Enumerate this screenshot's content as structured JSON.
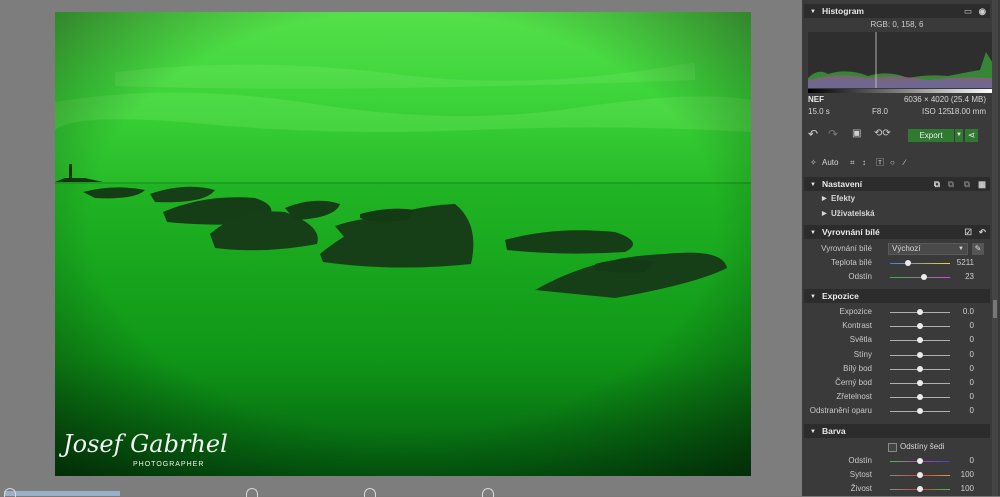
{
  "histogram": {
    "title": "Histogram",
    "rgb": "RGB: 0, 158, 6"
  },
  "file_info": {
    "format": "NEF",
    "dimensions": "6036 × 4020 (25.4 MB)",
    "shutter": "15.0 s",
    "aperture": "F8.0",
    "iso": "ISO 125",
    "focal": "18.00 mm"
  },
  "toolbar": {
    "export_label": "Export"
  },
  "tools": {
    "auto_label": "Auto"
  },
  "nastaveni": {
    "title": "Nastavení",
    "efekty": "Efekty",
    "uzivatelska": "Uživatelská"
  },
  "vyrovnani": {
    "title": "Vyrovnání bílé",
    "preset_label": "Vyrovnání bílé",
    "preset_value": "Výchozí",
    "sliders": [
      {
        "label": "Teplota bílé",
        "value": "5211",
        "pos": 0.3
      },
      {
        "label": "Odstín",
        "value": "23",
        "pos": 0.57
      }
    ]
  },
  "expozice": {
    "title": "Expozice",
    "sliders": [
      {
        "label": "Expozice",
        "value": "0.0",
        "pos": 0.5
      },
      {
        "label": "Kontrast",
        "value": "0",
        "pos": 0.5
      },
      {
        "label": "Světla",
        "value": "0",
        "pos": 0.5
      },
      {
        "label": "Stíny",
        "value": "0",
        "pos": 0.5
      },
      {
        "label": "Bílý bod",
        "value": "0",
        "pos": 0.5
      },
      {
        "label": "Černý bod",
        "value": "0",
        "pos": 0.5
      },
      {
        "label": "Zřetelnost",
        "value": "0",
        "pos": 0.5
      },
      {
        "label": "Odstranění oparu",
        "value": "0",
        "pos": 0.5
      }
    ]
  },
  "barva": {
    "title": "Barva",
    "grayscale_label": "Odstíny šedi",
    "sliders": [
      {
        "label": "Odstín",
        "value": "0",
        "pos": 0.5
      },
      {
        "label": "Sytost",
        "value": "100",
        "pos": 0.5
      },
      {
        "label": "Živost",
        "value": "100",
        "pos": 0.5
      }
    ]
  },
  "watermark": {
    "name": "Josef Gabrhel",
    "sub": "PHOTOGRAPHER"
  },
  "colors": {
    "photo_sky": "#3ed63a",
    "photo_sea": "#10a81a",
    "rock": "#123a14",
    "panel": "#3a3a3a",
    "accent_green": "#3a9c3a"
  }
}
